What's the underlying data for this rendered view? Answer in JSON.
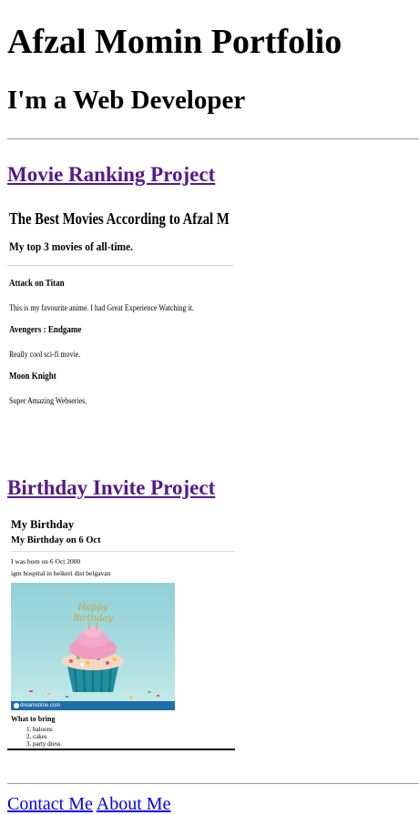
{
  "header": {
    "title": "Afzal Momin Portfolio",
    "subtitle": "I'm a Web Developer"
  },
  "projects": [
    {
      "link_label": "Movie Ranking Project"
    },
    {
      "link_label": "Birthday Invite Project"
    }
  ],
  "movie_page": {
    "title": "The Best Movies According to Afzal M",
    "subtitle": "My top 3 movies of all-time.",
    "movies": [
      {
        "name": "Attack on Titan",
        "description": "This is my favourite anime. I had Great Experience Watching it."
      },
      {
        "name": "Avengers : Endgame",
        "description": "Really cool sci-fi movie."
      },
      {
        "name": "Moon Knight",
        "description": "Super Amazing Webseries."
      }
    ]
  },
  "birthday_page": {
    "title": "My Birthday",
    "subtitle": "My Birthday on 6 Oct",
    "line1": "I was born on 6 Oct 2000",
    "line2": "igm hospital in heikeri dist belgavan",
    "image_text": "Happy Birthday",
    "image_credit": "dreamstime.com",
    "what_to_bring_label": "What to bring",
    "items": [
      "baloons",
      "cakes",
      "party dress"
    ]
  },
  "footer": {
    "contact_label": "Contact Me",
    "about_label": "About Me"
  },
  "colors": {
    "visited_link": "#551a8b",
    "link": "#0000ee"
  }
}
